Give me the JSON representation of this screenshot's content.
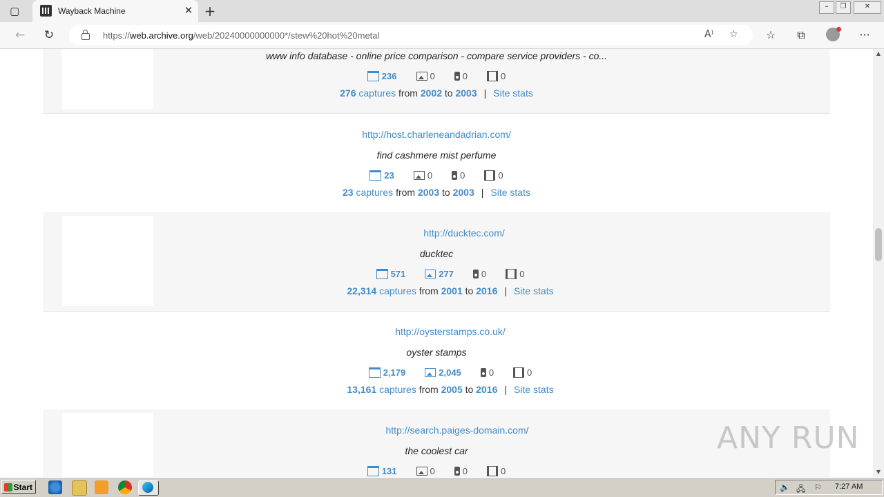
{
  "browser": {
    "tab_title": "Wayback Machine",
    "url_scheme": "https://",
    "url_host": "web.archive.org",
    "url_path": "/web/20240000000000*/stew%20hot%20metal"
  },
  "results": [
    {
      "url": "",
      "description": "www info database - online price comparison - compare service providers - co...",
      "web": "236",
      "images": "0",
      "audio": "0",
      "video": "0",
      "captures": "276",
      "captures_word": "captures",
      "from_word": "from",
      "from_year": "2002",
      "to_word": "to",
      "to_year": "2003",
      "site_stats": "Site stats"
    },
    {
      "url": "http://host.charleneandadrian.com/",
      "description": "find cashmere mist perfume",
      "web": "23",
      "images": "0",
      "audio": "0",
      "video": "0",
      "captures": "23",
      "captures_word": "captures",
      "from_word": "from",
      "from_year": "2003",
      "to_word": "to",
      "to_year": "2003",
      "site_stats": "Site stats"
    },
    {
      "url": "http://ducktec.com/",
      "description": "ducktec",
      "web": "571",
      "images": "277",
      "audio": "0",
      "video": "0",
      "captures": "22,314",
      "captures_word": "captures",
      "from_word": "from",
      "from_year": "2001",
      "to_word": "to",
      "to_year": "2016",
      "site_stats": "Site stats"
    },
    {
      "url": "http://oysterstamps.co.uk/",
      "description": "oyster stamps",
      "web": "2,179",
      "images": "2,045",
      "audio": "0",
      "video": "0",
      "captures": "13,161",
      "captures_word": "captures",
      "from_word": "from",
      "from_year": "2005",
      "to_word": "to",
      "to_year": "2016",
      "site_stats": "Site stats"
    },
    {
      "url": "http://search.paiges-domain.com/",
      "description": "the coolest car",
      "web": "131",
      "images": "0",
      "audio": "0",
      "video": "0"
    }
  ],
  "watermark": "ANY RUN",
  "taskbar": {
    "start_label": "Start",
    "clock": "7:27 AM"
  },
  "colors": {
    "link": "#428bca",
    "row_alt": "#f6f6f6"
  }
}
